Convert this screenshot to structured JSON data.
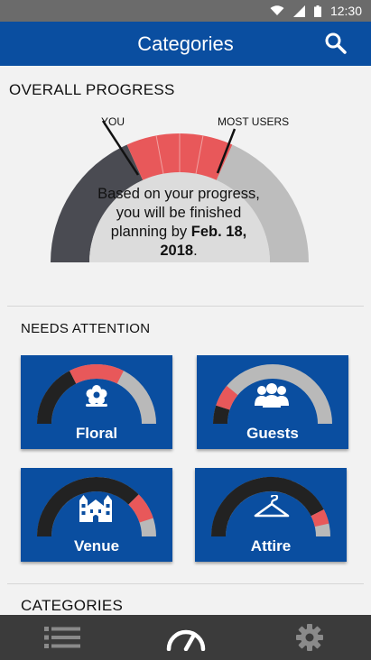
{
  "status_bar": {
    "time": "12:30"
  },
  "app_bar": {
    "title": "Categories"
  },
  "overall": {
    "title": "OVERALL PROGRESS",
    "label_you": "YOU",
    "label_most_users": "MOST USERS",
    "forecast_text": "Based on your progress, you will be finished planning by",
    "forecast_date": "Feb. 18, 2018",
    "forecast_end": "."
  },
  "needs_attention": {
    "title": "NEEDS ATTENTION",
    "tiles": [
      {
        "label": "Floral",
        "icon": "flower-icon",
        "progress_fraction": 0.35,
        "attention_span": 0.3
      },
      {
        "label": "Guests",
        "icon": "people-icon",
        "progress_fraction": 0.1,
        "attention_span": 0.12
      },
      {
        "label": "Venue",
        "icon": "building-icon",
        "progress_fraction": 0.75,
        "attention_span": 0.15
      },
      {
        "label": "Attire",
        "icon": "hanger-icon",
        "progress_fraction": 0.85,
        "attention_span": 0.08
      }
    ]
  },
  "categories": {
    "title": "CATEGORIES"
  },
  "bottom_nav": [
    {
      "icon": "list-icon"
    },
    {
      "icon": "speedometer-icon"
    },
    {
      "icon": "gear-icon"
    }
  ],
  "colors": {
    "primary": "#0a4ea0",
    "attention": "#e8585a",
    "progress_dark": "#222222",
    "track_grey": "#b9b9b9"
  }
}
